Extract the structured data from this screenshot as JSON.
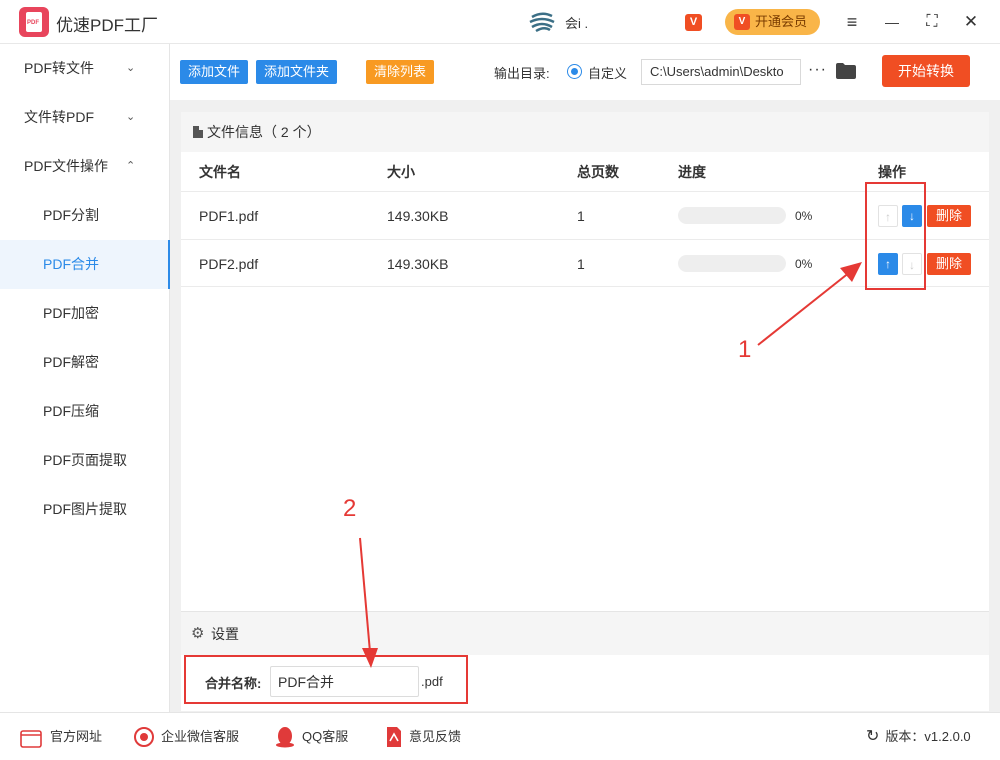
{
  "app": {
    "title": "优速PDF工厂",
    "logo_text": "PDF",
    "user": "会i ."
  },
  "titlebar": {
    "vip_badge": "V",
    "vip_button": "开通会员",
    "menu_icon": "≡",
    "min_icon": "—",
    "max_icon": "⛶",
    "close_icon": "✕"
  },
  "sidebar": {
    "groups": [
      {
        "label": "PDF转文件",
        "chevron": "⌄"
      },
      {
        "label": "文件转PDF",
        "chevron": "⌄"
      },
      {
        "label": "PDF文件操作",
        "chevron": "⌃"
      }
    ],
    "items": [
      "PDF分割",
      "PDF合并",
      "PDF加密",
      "PDF解密",
      "PDF压缩",
      "PDF页面提取",
      "PDF图片提取"
    ],
    "active_item": "PDF合并"
  },
  "toolbar": {
    "add_file": "添加文件",
    "add_folder": "添加文件夹",
    "clear_list": "清除列表",
    "output_label": "输出目录:",
    "radio_label": "自定义",
    "path_value": "C:\\Users\\admin\\Deskto",
    "more": "···",
    "start": "开始转换"
  },
  "file_panel": {
    "title": "文件信息（ 2 个）",
    "columns": {
      "name": "文件名",
      "size": "大小",
      "pages": "总页数",
      "progress": "进度",
      "actions": "操作"
    },
    "rows": [
      {
        "name": "PDF1.pdf",
        "size": "149.30KB",
        "pages": "1",
        "progress_pct": 0,
        "progress_label": "0%",
        "delete": "删除",
        "up_enabled": false,
        "down_enabled": true
      },
      {
        "name": "PDF2.pdf",
        "size": "149.30KB",
        "pages": "1",
        "progress_pct": 0,
        "progress_label": "0%",
        "delete": "删除",
        "up_enabled": true,
        "down_enabled": false
      }
    ]
  },
  "settings": {
    "title": "设置",
    "merge_label": "合并名称:",
    "merge_value": "PDF合并",
    "merge_ext": ".pdf"
  },
  "footer": {
    "website": "官方网址",
    "wechat": "企业微信客服",
    "qq": "QQ客服",
    "feedback": "意见反馈",
    "version": "版本：v1.2.0.0"
  },
  "annotations": {
    "one": "1",
    "two": "2"
  },
  "colors": {
    "accent": "#2b8ae8",
    "danger": "#f04e23",
    "warning": "#f89a22",
    "vip": "#f9b548",
    "annotation": "#e53935"
  }
}
